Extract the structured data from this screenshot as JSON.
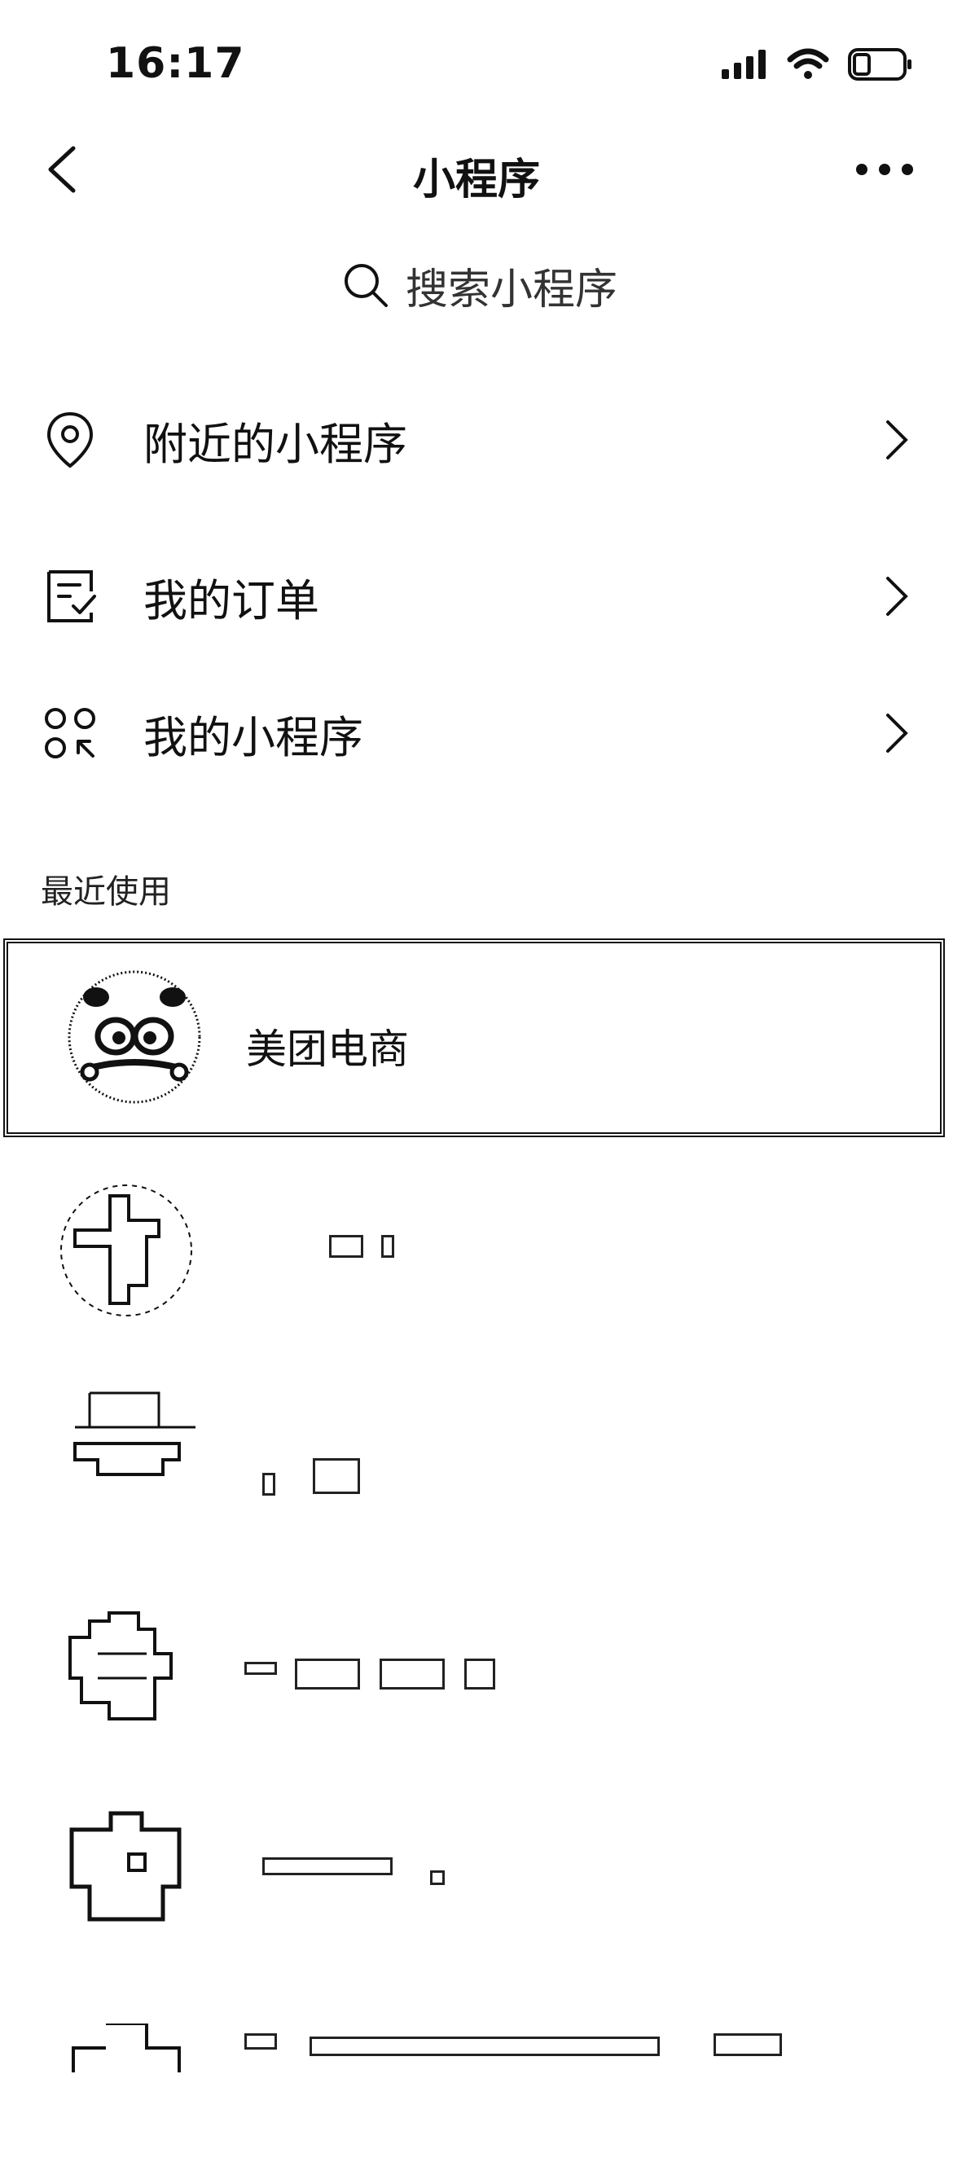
{
  "status": {
    "time": "16:17"
  },
  "nav": {
    "title": "小程序"
  },
  "search": {
    "placeholder": "搜索小程序"
  },
  "menu": [
    {
      "label": "附近的小程序",
      "icon": "location-pin-icon"
    },
    {
      "label": "我的订单",
      "icon": "order-list-icon"
    },
    {
      "label": "我的小程序",
      "icon": "mini-program-grid-icon"
    }
  ],
  "recent": {
    "section_label": "最近使用",
    "items": [
      {
        "name": "美团电商",
        "icon": "panda-avatar-icon"
      }
    ]
  }
}
